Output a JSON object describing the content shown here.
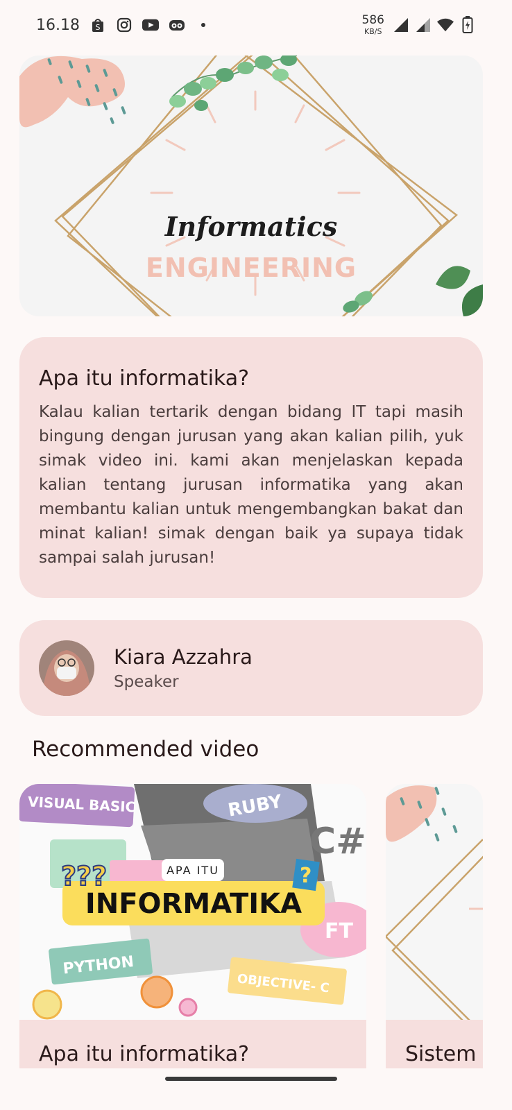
{
  "status_bar": {
    "time": "16.18",
    "net_speed": "586",
    "net_unit": "KB/S",
    "icons": [
      "shopee-icon",
      "instagram-icon",
      "youtube-icon",
      "tripadvisor-icon",
      "dot-icon",
      "signal-icon",
      "signal-icon",
      "wifi-icon",
      "battery-icon"
    ]
  },
  "hero": {
    "title": "Informatics",
    "subtitle": "ENGINEERING"
  },
  "info": {
    "title": "Apa itu informatika?",
    "body": "Kalau kalian tertarik dengan bidang IT tapi masih bingung dengan jurusan yang akan kalian pilih, yuk simak video ini. kami akan menjelaskan kepada kalian tentang jurusan informatika yang akan membantu kalian untuk mengembangkan bakat dan minat kalian! simak dengan baik ya supaya tidak sampai salah jurusan!"
  },
  "speaker": {
    "name": "Kiara Azzahra",
    "role": "Speaker"
  },
  "recommended": {
    "section_title": "Recommended video",
    "videos": [
      {
        "title": "Apa itu informatika?",
        "thumb_labels": {
          "visual_basic": "VISUAL BASIC",
          "ruby": "RUBY",
          "csharp": "C#",
          "apa_itu": "APA ITU",
          "informatika": "INFORMATIKA",
          "python": "PYTHON",
          "objective_c": "OBJECTIVE- C",
          "swift_partial": "FT"
        }
      },
      {
        "title": "Sistem"
      }
    ]
  },
  "colors": {
    "background": "#fdf8f7",
    "card": "#f6dfde",
    "accent_peach": "#f2c0b2",
    "gold": "#c9a36b"
  }
}
